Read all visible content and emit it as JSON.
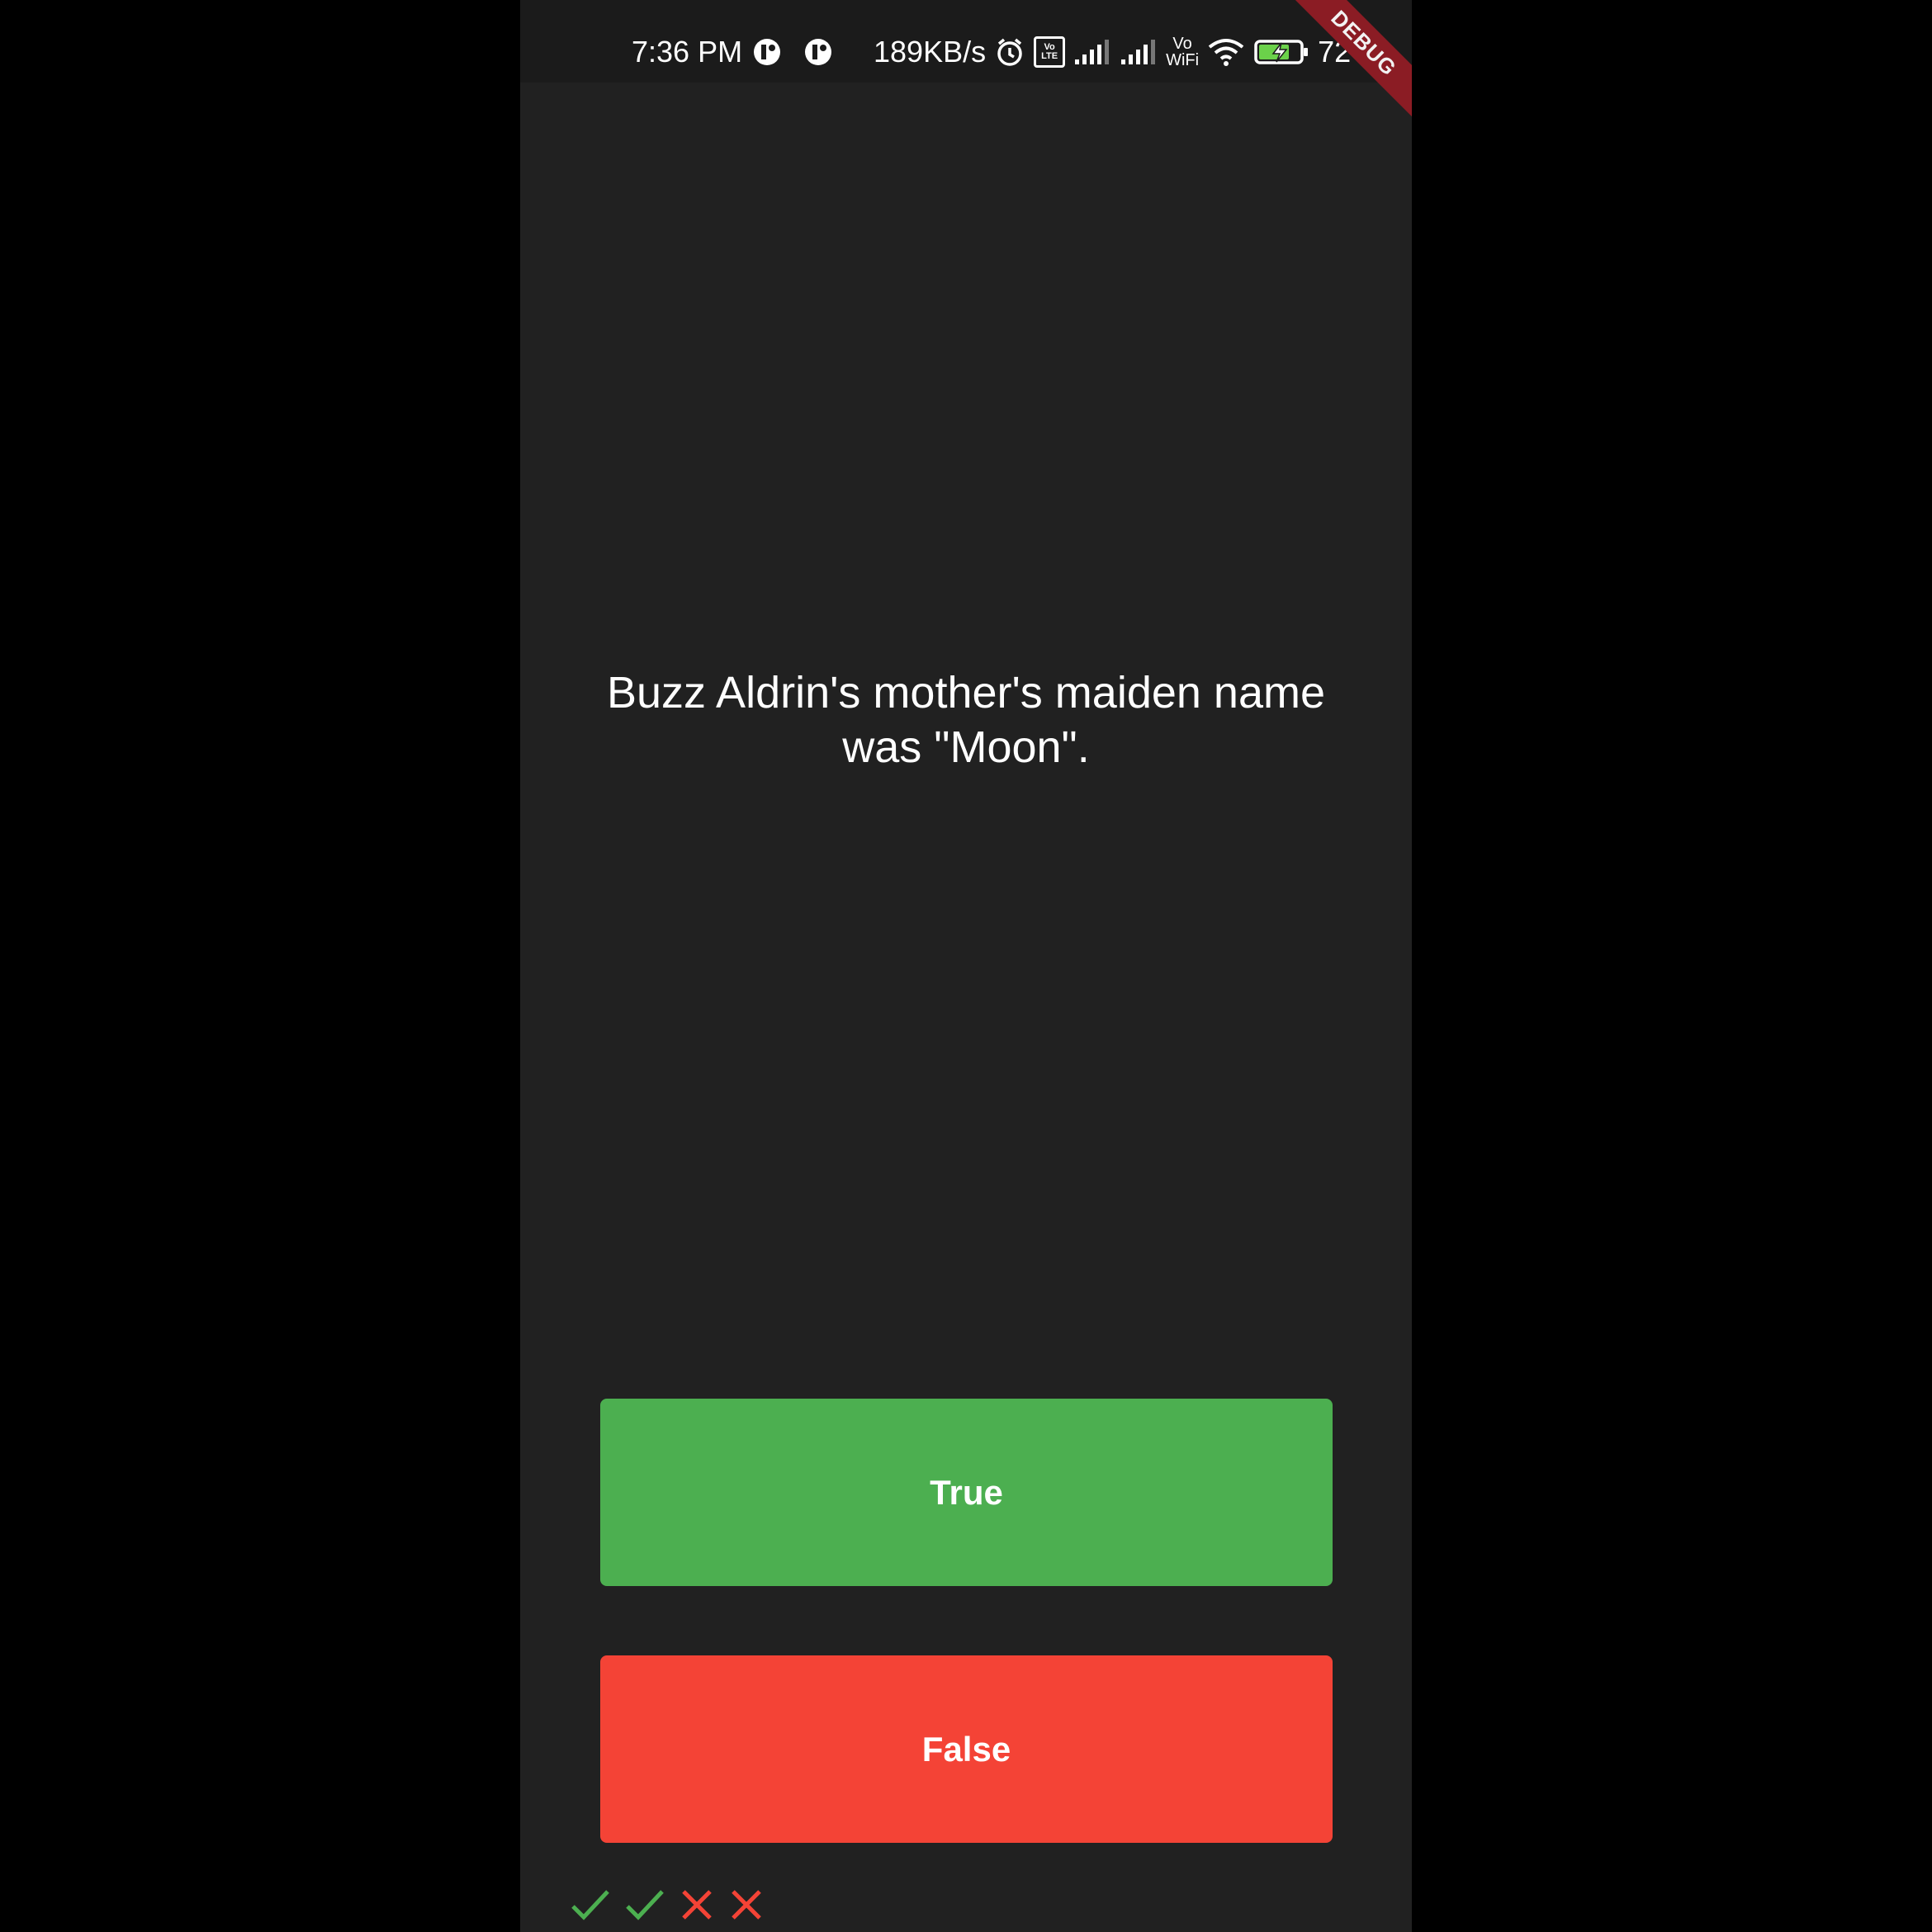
{
  "status_bar": {
    "time": "7:36 PM",
    "network_speed": "189KB/s",
    "vowifi_top": "Vo",
    "vowifi_bottom": "WiFi",
    "volte_top": "Vo",
    "volte_bottom": "LTE",
    "battery_level": "72",
    "icons": [
      "app-notification-icon",
      "app-notification-icon",
      "alarm-icon",
      "volte-icon",
      "signal-icon",
      "signal-icon",
      "vowifi-icon",
      "wifi-icon",
      "battery-charging-icon"
    ]
  },
  "debug_banner": "DEBUG",
  "quiz": {
    "question": "Buzz Aldrin's mother's maiden name was \"Moon\".",
    "true_label": "True",
    "false_label": "False",
    "score_marks": [
      {
        "icon": "check-icon",
        "result": "correct"
      },
      {
        "icon": "check-icon",
        "result": "correct"
      },
      {
        "icon": "close-icon",
        "result": "wrong"
      },
      {
        "icon": "close-icon",
        "result": "wrong"
      }
    ]
  },
  "colors": {
    "background": "#212121",
    "true_button": "#4caf50",
    "false_button": "#f44336",
    "correct_mark": "#4caf50",
    "wrong_mark": "#f44336",
    "debug_banner": "#8b1c24"
  }
}
